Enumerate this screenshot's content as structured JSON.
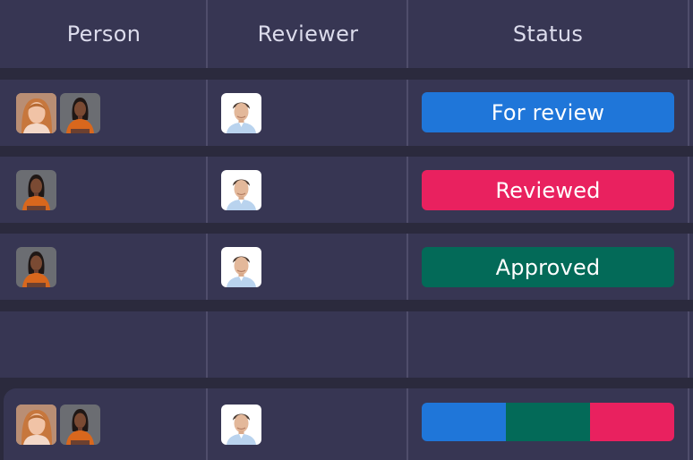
{
  "columns": {
    "person": "Person",
    "reviewer": "Reviewer",
    "status": "Status"
  },
  "rows": [
    {
      "persons": [
        "woman-light-avatar",
        "woman-dark-avatar"
      ],
      "reviewer": "man-avatar",
      "status": "For review",
      "status_color": "#1f76d9"
    },
    {
      "persons": [
        "woman-dark-avatar"
      ],
      "reviewer": "man-avatar",
      "status": "Reviewed",
      "status_color": "#e9215f"
    },
    {
      "persons": [
        "woman-dark-avatar"
      ],
      "reviewer": "man-avatar",
      "status": "Approved",
      "status_color": "#036a58"
    }
  ],
  "summary": {
    "persons": [
      "woman-light-avatar",
      "woman-dark-avatar"
    ],
    "reviewer": "man-avatar",
    "status_distribution": [
      {
        "color": "#1f76d9",
        "fraction": 0.333
      },
      {
        "color": "#036a58",
        "fraction": 0.334
      },
      {
        "color": "#e9215f",
        "fraction": 0.333
      }
    ]
  },
  "colors": {
    "background": "#2b2a3d",
    "row": "#373653",
    "divider": "#4f4d6b",
    "header_text": "#dcdcec"
  }
}
